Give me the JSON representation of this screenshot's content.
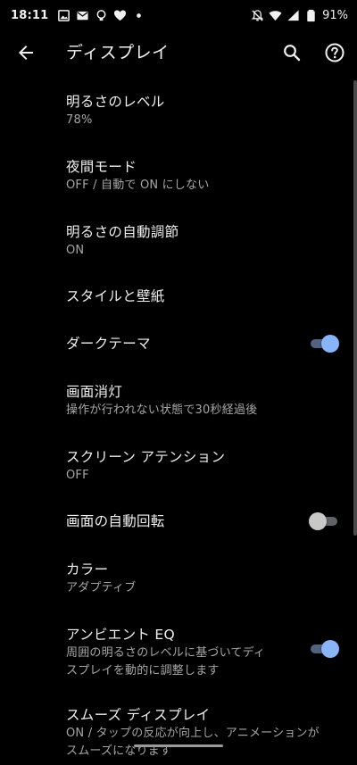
{
  "status_bar": {
    "time": "18:11",
    "battery": "91%",
    "left_icons": [
      "image-icon",
      "mail-icon",
      "bulb-icon",
      "heart-icon",
      "dot-icon"
    ],
    "right_icons": [
      "notifications-off-icon",
      "wifi-icon",
      "signal-icon",
      "battery-icon"
    ]
  },
  "app_bar": {
    "title": "ディスプレイ"
  },
  "settings": {
    "brightness": {
      "title": "明るさのレベル",
      "summary": "78%"
    },
    "night_mode": {
      "title": "夜間モード",
      "summary": "OFF / 自動で ON にしない"
    },
    "adaptive_brightness": {
      "title": "明るさの自動調節",
      "summary": "ON"
    },
    "style": {
      "title": "スタイルと壁紙"
    },
    "dark_theme": {
      "title": "ダークテーマ",
      "enabled": true
    },
    "screen_timeout": {
      "title": "画面消灯",
      "summary": "操作が行われない状態で30秒経過後"
    },
    "screen_attention": {
      "title": "スクリーン アテンション",
      "summary": "OFF"
    },
    "auto_rotate": {
      "title": "画面の自動回転",
      "enabled": false
    },
    "colors": {
      "title": "カラー",
      "summary": "アダプティブ"
    },
    "ambient_eq": {
      "title": "アンビエント EQ",
      "summary_line1": "周囲の明るさのレベルに基づいてディ",
      "summary_line2": "スプレイを動的に調整します",
      "enabled": true
    },
    "smooth_display": {
      "title": "スムーズ ディスプレイ",
      "summary_line1": "ON / タップの反応が向上し、アニメーションが",
      "summary_line2": "スムーズになります"
    }
  },
  "colors": {
    "background": "#000000",
    "toggle_on_thumb": "#8ab4f8",
    "toggle_on_track": "#52627f",
    "toggle_off_thumb": "#c8c8c8"
  }
}
